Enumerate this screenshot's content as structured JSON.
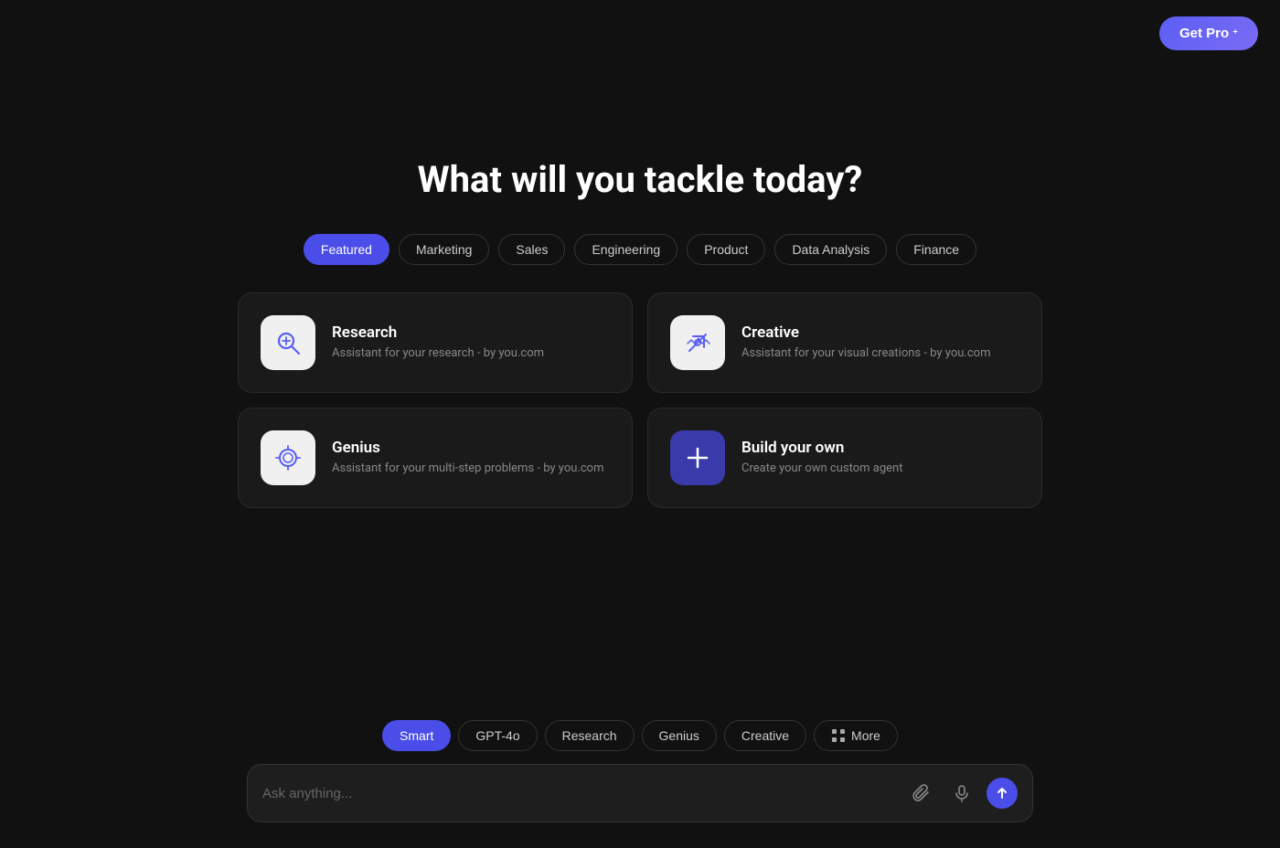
{
  "header": {
    "get_pro_label": "Get Pro"
  },
  "main": {
    "title": "What will you tackle today?",
    "categories": [
      {
        "id": "featured",
        "label": "Featured",
        "active": true
      },
      {
        "id": "marketing",
        "label": "Marketing",
        "active": false
      },
      {
        "id": "sales",
        "label": "Sales",
        "active": false
      },
      {
        "id": "engineering",
        "label": "Engineering",
        "active": false
      },
      {
        "id": "product",
        "label": "Product",
        "active": false
      },
      {
        "id": "data-analysis",
        "label": "Data Analysis",
        "active": false
      },
      {
        "id": "finance",
        "label": "Finance",
        "active": false
      }
    ],
    "agents": [
      {
        "id": "research",
        "name": "Research",
        "desc": "Assistant for your research - by you.com",
        "icon_type": "research"
      },
      {
        "id": "creative",
        "name": "Creative",
        "desc": "Assistant for your visual creations - by you.com",
        "icon_type": "creative"
      },
      {
        "id": "genius",
        "name": "Genius",
        "desc": "Assistant for your multi-step problems - by you.com",
        "icon_type": "genius"
      },
      {
        "id": "build",
        "name": "Build your own",
        "desc": "Create your own custom agent",
        "icon_type": "build"
      }
    ]
  },
  "bottom": {
    "modes": [
      {
        "id": "smart",
        "label": "Smart",
        "active": true
      },
      {
        "id": "gpt4o",
        "label": "GPT-4o",
        "active": false
      },
      {
        "id": "research",
        "label": "Research",
        "active": false
      },
      {
        "id": "genius",
        "label": "Genius",
        "active": false
      },
      {
        "id": "creative",
        "label": "Creative",
        "active": false
      },
      {
        "id": "more",
        "label": "More",
        "active": false
      }
    ],
    "input_placeholder": "Ask anything..."
  },
  "colors": {
    "accent": "#4a4de8",
    "bg": "#111111",
    "card_bg": "#1a1a1a"
  }
}
